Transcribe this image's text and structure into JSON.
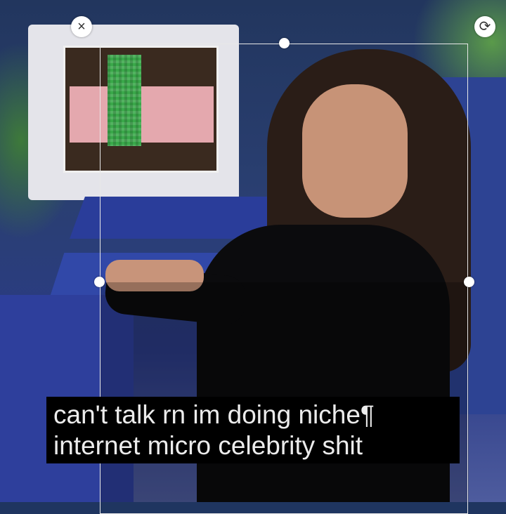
{
  "caption": {
    "line1": "can't talk rn im doing niche",
    "pilcrow": "¶",
    "line2": "internet micro celebrity shit"
  },
  "controls": {
    "close_icon": "×",
    "rotate_icon": "⟳"
  }
}
